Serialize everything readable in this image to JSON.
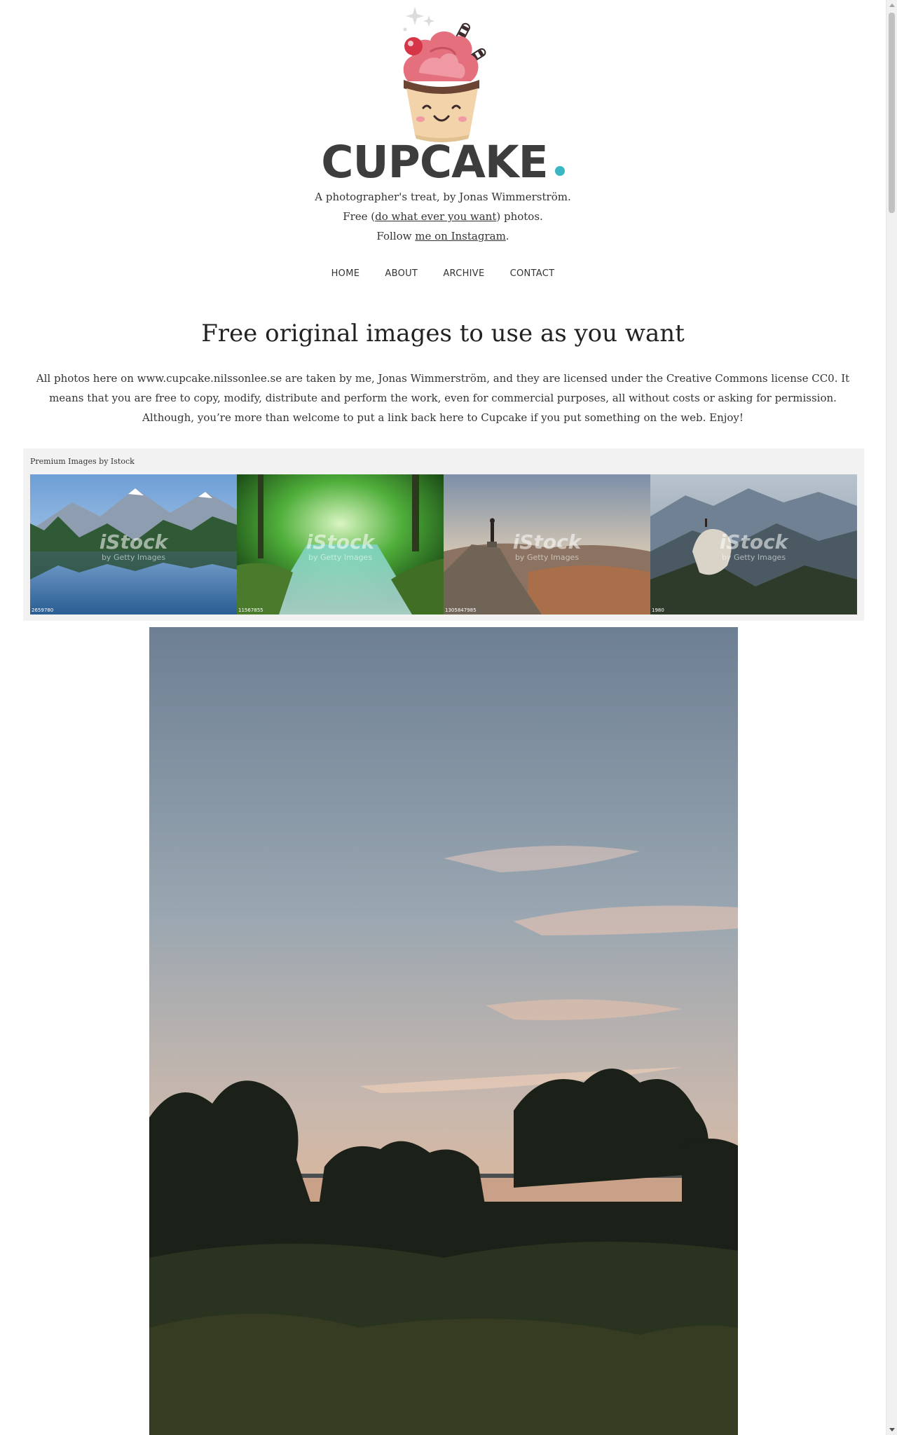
{
  "site": {
    "title": "CUPCAKE",
    "tagline_line1": "A photographer's treat, by Jonas Wimmerström.",
    "tagline_free_prefix": "Free (",
    "tagline_free_link": "do what ever you want",
    "tagline_free_suffix": ") photos.",
    "tagline_follow_prefix": "Follow ",
    "tagline_follow_link": "me on Instagram",
    "tagline_follow_suffix": "."
  },
  "nav": {
    "items": [
      {
        "label": "HOME"
      },
      {
        "label": "ABOUT"
      },
      {
        "label": "ARCHIVE"
      },
      {
        "label": "CONTACT"
      }
    ]
  },
  "main": {
    "headline": "Free original images to use as you want",
    "intro": "All photos here on www.cupcake.nilssonlee.se are taken by me, Jonas Wimmerström, and they are licensed under the Creative Commons license CC0. It means that you are free to copy, modify, distribute and perform the work, even for commercial purposes, all without costs or asking for permission. Although, you’re more than welcome to put a link back here to Cupcake if you put something on the web. Enjoy!"
  },
  "istock": {
    "label": "Premium Images by Istock",
    "watermark": "iStock",
    "watermark_sub": "by Getty Images",
    "images": [
      {
        "name": "mountain-lake",
        "id": "2659780"
      },
      {
        "name": "forest-stream",
        "id": "11567855"
      },
      {
        "name": "hiker-on-rock",
        "id": "1305847985"
      },
      {
        "name": "mountain-peak",
        "id": "1980"
      }
    ]
  },
  "colors": {
    "brand_text": "#3d3d3d",
    "brand_dot": "#3ab7c3",
    "panel_bg": "#f2f2f2"
  },
  "icons": {
    "logo": "cupcake-icon"
  }
}
